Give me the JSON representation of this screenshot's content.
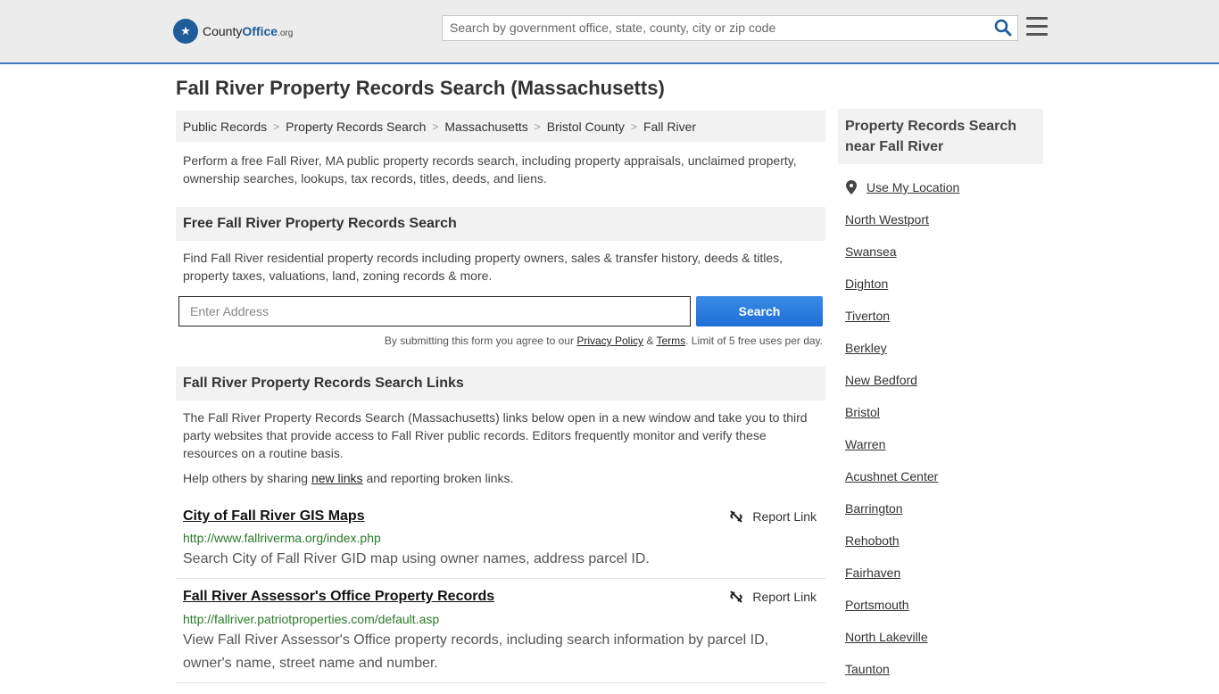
{
  "header": {
    "logo_main": "County",
    "logo_bold": "Office",
    "logo_suffix": ".org",
    "search_placeholder": "Search by government office, state, county, city or zip code"
  },
  "page_title": "Fall River Property Records Search (Massachusetts)",
  "breadcrumb": [
    "Public Records",
    "Property Records Search",
    "Massachusetts",
    "Bristol County",
    "Fall River"
  ],
  "intro": "Perform a free Fall River, MA public property records search, including property appraisals, unclaimed property, ownership searches, lookups, tax records, titles, deeds, and liens.",
  "free_search": {
    "heading": "Free Fall River Property Records Search",
    "text": "Find Fall River residential property records including property owners, sales & transfer history, deeds & titles, property taxes, valuations, land, zoning records & more.",
    "address_placeholder": "Enter Address",
    "button": "Search",
    "disclaimer_pre": "By submitting this form you agree to our ",
    "privacy": "Privacy Policy",
    "amp": " & ",
    "terms": "Terms",
    "disclaimer_post": ". Limit of 5 free uses per day."
  },
  "links_section": {
    "heading": "Fall River Property Records Search Links",
    "intro": "The Fall River Property Records Search (Massachusetts) links below open in a new window and take you to third party websites that provide access to Fall River public records. Editors frequently monitor and verify these resources on a routine basis.",
    "help_pre": "Help others by sharing ",
    "help_link": "new links",
    "help_post": " and reporting broken links.",
    "report_label": "Report Link",
    "items": [
      {
        "title": "City of Fall River GIS Maps",
        "url": "http://www.fallriverma.org/index.php",
        "desc": "Search City of Fall River GID map using owner names, address parcel ID."
      },
      {
        "title": "Fall River Assessor's Office Property Records",
        "url": "http://fallriver.patriotproperties.com/default.asp",
        "desc": "View Fall River Assessor's Office property records, including search information by parcel ID, owner's name, street name and number."
      }
    ]
  },
  "sidebar": {
    "heading": "Property Records Search near Fall River",
    "use_location": "Use My Location",
    "places": [
      "North Westport",
      "Swansea",
      "Dighton",
      "Tiverton",
      "Berkley",
      "New Bedford",
      "Bristol",
      "Warren",
      "Acushnet Center",
      "Barrington",
      "Rehoboth",
      "Fairhaven",
      "Portsmouth",
      "North Lakeville",
      "Taunton"
    ]
  },
  "colors": {
    "accent": "#3b7bbf",
    "button": "#1f6fd6",
    "url_green": "#2a7a2a"
  }
}
